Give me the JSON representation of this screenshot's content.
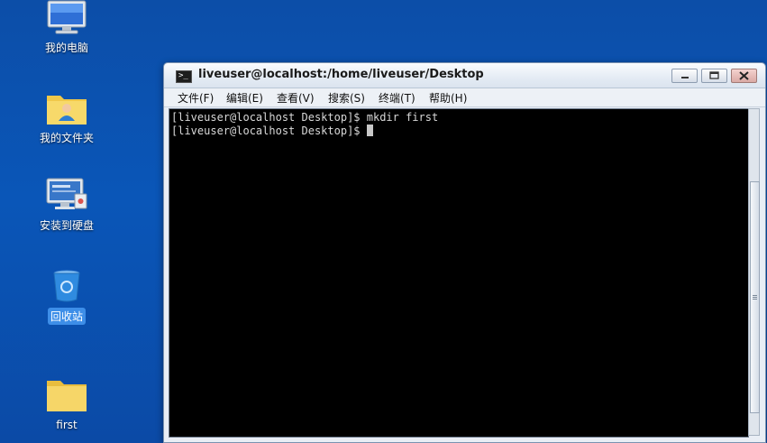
{
  "desktop": {
    "icons": [
      {
        "label": "我的电脑",
        "icon": "computer-icon"
      },
      {
        "label": "我的文件夹",
        "icon": "home-folder-icon"
      },
      {
        "label": "安装到硬盘",
        "icon": "install-icon"
      },
      {
        "label": "回收站",
        "icon": "trash-icon"
      },
      {
        "label": "first",
        "icon": "folder-icon"
      }
    ]
  },
  "window": {
    "title": "liveuser@localhost:/home/liveuser/Desktop",
    "icon": "terminal-icon",
    "icon_glyph": ">_",
    "menu": [
      "文件(F)",
      "编辑(E)",
      "查看(V)",
      "搜索(S)",
      "终端(T)",
      "帮助(H)"
    ]
  },
  "terminal": {
    "lines": [
      "[liveuser@localhost Desktop]$ mkdir first",
      "[liveuser@localhost Desktop]$ "
    ]
  },
  "colors": {
    "desktop_bg": "#0b50ad",
    "selection": "#3d8ee8",
    "terminal_bg": "#000000",
    "terminal_fg": "#d8d8d8"
  }
}
